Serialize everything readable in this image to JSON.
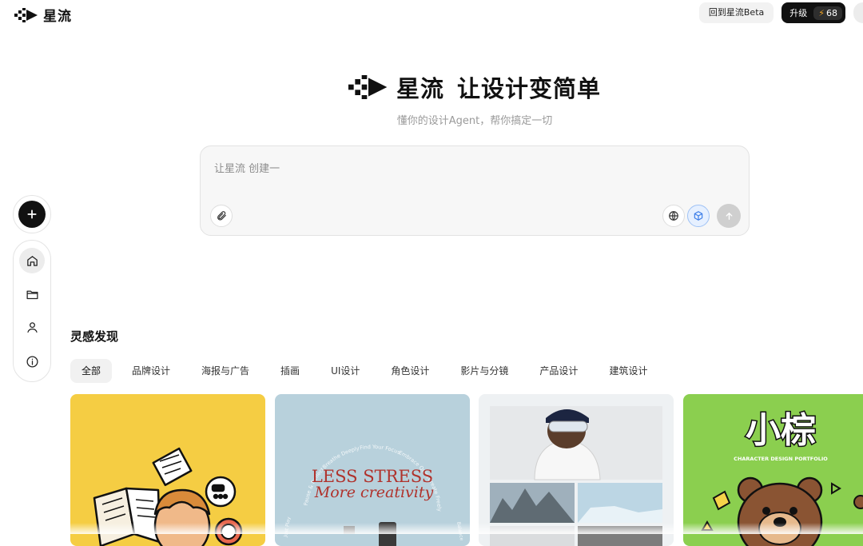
{
  "header": {
    "logo_text": "星流",
    "back_label": "回到星流Beta",
    "upgrade_label": "升级",
    "credits": "68"
  },
  "hero": {
    "brand": "星流",
    "slogan": "让设计变简单",
    "subtitle": "懂你的设计Agent，帮你搞定一切"
  },
  "prompt": {
    "placeholder": "让星流 创建一"
  },
  "sidebar": {
    "items": [
      {
        "name": "home",
        "icon": "home-icon",
        "active": true
      },
      {
        "name": "projects",
        "icon": "folder-icon",
        "active": false
      },
      {
        "name": "profile",
        "icon": "user-icon",
        "active": false
      },
      {
        "name": "about",
        "icon": "info-icon",
        "active": false
      }
    ]
  },
  "inspiration": {
    "title": "灵感发现",
    "tabs": [
      {
        "label": "全部",
        "active": true
      },
      {
        "label": "品牌设计"
      },
      {
        "label": "海报与广告"
      },
      {
        "label": "插画"
      },
      {
        "label": "UI设计"
      },
      {
        "label": "角色设计"
      },
      {
        "label": "影片与分镜"
      },
      {
        "label": "产品设计"
      },
      {
        "label": "建筑设计"
      }
    ],
    "cards": [
      {
        "theme": "illustration-reading"
      },
      {
        "theme": "poster",
        "headline": "LESS STRESS",
        "subline": "More creativity",
        "ring": [
          "Find Your Focus",
          "Embrace Quiet",
          "Create Freely",
          "Breathe Deeply",
          "Pause & Reflect",
          "Balance",
          "Just Play"
        ]
      },
      {
        "theme": "product-apparel"
      },
      {
        "theme": "character",
        "title": "小棕",
        "subtitle": "CHARACTER DESIGN PORTFOLIO"
      }
    ]
  },
  "colors": {
    "accent_dark": "#111111",
    "credits_bolt": "#f5a623",
    "card_yellow": "#f5cd43",
    "card_blue": "#b8d1dc",
    "card_green": "#8bcf4f"
  }
}
